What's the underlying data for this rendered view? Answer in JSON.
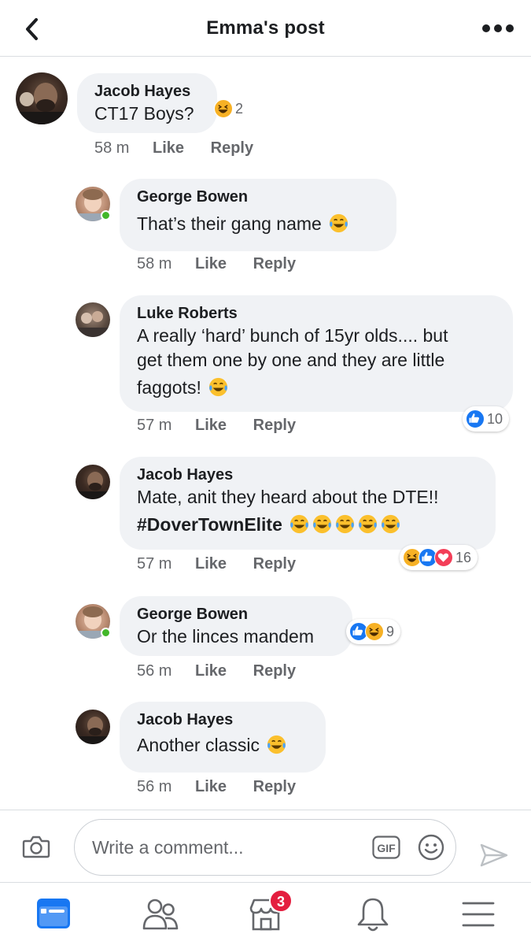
{
  "header": {
    "title": "Emma's post",
    "back_icon": "chevron-left-icon",
    "more_icon": "more-horizontal-icon"
  },
  "comments": [
    {
      "author": "Jacob Hayes",
      "text": "CT17 Boys?",
      "time": "58 m",
      "like": "Like",
      "reply": "Reply",
      "reaction_count": "2",
      "reactions": [
        "haha"
      ]
    },
    {
      "author": "George Bowen",
      "text": "That’s their gang name",
      "emoji": "😂",
      "time": "58 m",
      "like": "Like",
      "reply": "Reply",
      "online": true
    },
    {
      "author": "Luke Roberts",
      "text_line1": "A really ‘hard’ bunch of 15yr olds.... but",
      "text_line2": "get them one by one and they are little",
      "text_line3": "faggots!",
      "time": "57 m",
      "like": "Like",
      "reply": "Reply",
      "reaction_count": "10",
      "reactions": [
        "like"
      ]
    },
    {
      "author": "Jacob Hayes",
      "text_line1": "Mate, anit they heard about the DTE!!",
      "hashtag": "#DoverTownElite",
      "time": "57 m",
      "like": "Like",
      "reply": "Reply",
      "reaction_count": "16",
      "reactions": [
        "haha",
        "like",
        "love"
      ]
    },
    {
      "author": "George Bowen",
      "text": "Or the linces mandem",
      "time": "56 m",
      "like": "Like",
      "reply": "Reply",
      "reaction_count": "9",
      "reactions": [
        "like",
        "haha"
      ],
      "online": true
    },
    {
      "author": "Jacob Hayes",
      "text": "Another classic",
      "time": "56 m",
      "like": "Like",
      "reply": "Reply"
    }
  ],
  "composer": {
    "placeholder": "Write a comment...",
    "gif_label": "GIF"
  },
  "bottom_nav": {
    "marketplace_badge": "3",
    "items": [
      "news-feed-icon",
      "friends-icon",
      "marketplace-icon",
      "notifications-icon",
      "menu-icon"
    ]
  },
  "colors": {
    "accent": "#1877f2",
    "bubble": "#f0f2f5",
    "secondary_text": "#65676b",
    "badge": "#e41e3f",
    "online": "#42b72a"
  }
}
